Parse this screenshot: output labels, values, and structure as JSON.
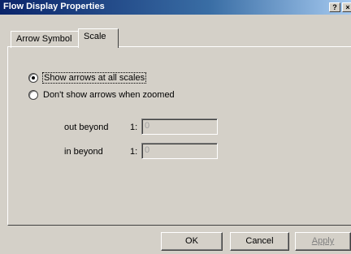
{
  "window": {
    "title": "Flow Display Properties",
    "help_glyph": "?",
    "close_glyph": "×"
  },
  "tabs": [
    {
      "label": "Arrow Symbol",
      "active": false
    },
    {
      "label": "Scale",
      "active": true
    }
  ],
  "scale": {
    "option_all": {
      "label": "Show arrows at all scales",
      "checked": true
    },
    "option_zoom": {
      "label": "Don't show arrows when zoomed",
      "checked": false
    },
    "out_beyond": {
      "label": "out beyond",
      "prefix": "1:",
      "value": "0"
    },
    "in_beyond": {
      "label": "in beyond",
      "prefix": "1:",
      "value": "0"
    }
  },
  "buttons": {
    "ok": "OK",
    "cancel": "Cancel",
    "apply": "Apply"
  }
}
